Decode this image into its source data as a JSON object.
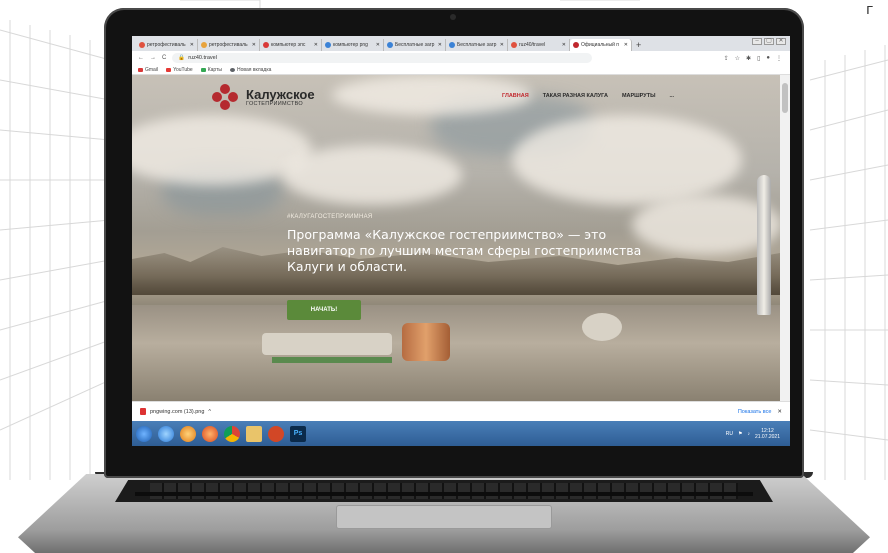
{
  "corner_mark": "г",
  "browser": {
    "tabs": [
      {
        "label": "ретрофестиваль",
        "color": "#e0523f"
      },
      {
        "label": "ретрофестиваль",
        "color": "#e8a33c"
      },
      {
        "label": "компьютер эпс",
        "color": "#d93838"
      },
      {
        "label": "компьютер png",
        "color": "#3b82d6"
      },
      {
        "label": "Бесплатные загр",
        "color": "#3b82d6"
      },
      {
        "label": "Бесплатные загр",
        "color": "#3b82d6"
      },
      {
        "label": "ruz40/travel",
        "color": "#e0523f"
      },
      {
        "label": "Официальный п",
        "color": "#c0272d"
      }
    ],
    "new_tab": "+",
    "window_controls": [
      "–",
      "▢",
      "✕"
    ],
    "url": "ruz40.travel",
    "bookmarks": [
      {
        "label": "Gmail",
        "color": "#d93838"
      },
      {
        "label": "YouTube",
        "color": "#e53935"
      },
      {
        "label": "Карты",
        "color": "#34a853"
      },
      {
        "label": "Новая вкладка",
        "color": "#5f6368"
      }
    ]
  },
  "site": {
    "logo_title": "Калужское",
    "logo_subtitle": "ГОСТЕПРИИМСТВО",
    "nav": [
      "ГЛАВНАЯ",
      "ТАКАЯ РАЗНАЯ КАЛУГА",
      "МАРШРУТЫ",
      "..."
    ],
    "kicker": "#КАЛУГАГОСТЕПРИИМНАЯ",
    "hero": "Программа «Калужское гостеприимство» — это навигатор по лучшим местам сферы гостеприимства Калуги и области.",
    "cta": "НАЧАТЬ!",
    "accent": "#c0272d",
    "cta_color": "#5b8a3a"
  },
  "downloads": {
    "file": "pngwing.com (13).png",
    "chevron": "^",
    "show_all": "Показать все",
    "close": "✕"
  },
  "taskbar": {
    "apps": [
      "windows-start",
      "ie",
      "media-player",
      "firefox",
      "chrome",
      "explorer",
      "powerpoint",
      "photoshop"
    ],
    "ps_label": "Ps",
    "lang": "RU",
    "time": "12:12",
    "date": "21.07.2021"
  }
}
